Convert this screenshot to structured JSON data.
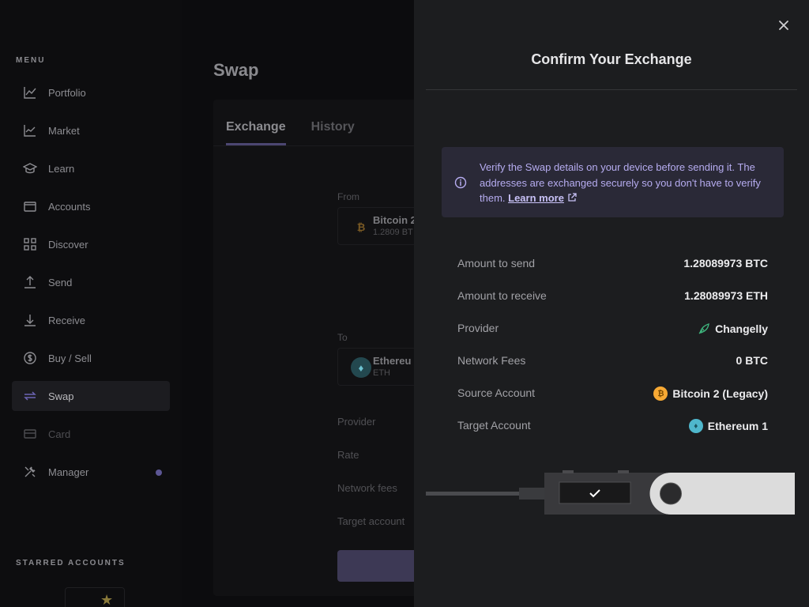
{
  "sidebar": {
    "menu_heading": "MENU",
    "items": [
      {
        "label": "Portfolio",
        "icon": "chart-line-icon"
      },
      {
        "label": "Market",
        "icon": "market-icon"
      },
      {
        "label": "Learn",
        "icon": "graduation-cap-icon"
      },
      {
        "label": "Accounts",
        "icon": "wallet-icon"
      },
      {
        "label": "Discover",
        "icon": "grid-icon"
      },
      {
        "label": "Send",
        "icon": "arrow-up-icon"
      },
      {
        "label": "Receive",
        "icon": "arrow-down-icon"
      },
      {
        "label": "Buy / Sell",
        "icon": "dollar-icon"
      },
      {
        "label": "Swap",
        "icon": "swap-icon",
        "active": true
      },
      {
        "label": "Card",
        "icon": "card-icon",
        "disabled": true
      },
      {
        "label": "Manager",
        "icon": "tools-icon",
        "notification": true
      }
    ],
    "starred_heading": "STARRED ACCOUNTS"
  },
  "main": {
    "title": "Swap",
    "tabs": [
      {
        "label": "Exchange",
        "active": true
      },
      {
        "label": "History",
        "active": false
      }
    ],
    "from_label": "From",
    "from_account": {
      "name": "Bitcoin 2",
      "sub": "1.2809 BT"
    },
    "to_label": "To",
    "to_account": {
      "name": "Ethereu",
      "sub": "ETH"
    },
    "summary_labels": [
      "Provider",
      "Rate",
      "Network fees",
      "Target account"
    ]
  },
  "drawer": {
    "title": "Confirm Your Exchange",
    "alert": {
      "text": "Verify the Swap details on your device before sending it. The addresses are exchanged securely so you don't have to verify them.",
      "link": "Learn more"
    },
    "rows": [
      {
        "label": "Amount to send",
        "value": "1.28089973 BTC"
      },
      {
        "label": "Amount to receive",
        "value": "1.28089973 ETH"
      },
      {
        "label": "Provider",
        "value": "Changelly",
        "icon": "changelly-icon"
      },
      {
        "label": "Network Fees",
        "value": "0 BTC"
      },
      {
        "label": "Source Account",
        "value": "Bitcoin 2 (Legacy)",
        "icon": "bitcoin-icon"
      },
      {
        "label": "Target Account",
        "value": "Ethereum 1",
        "icon": "ethereum-icon"
      }
    ]
  },
  "colors": {
    "accent": "#6490f1",
    "bitcoin": "#f7a934",
    "ethereum": "#4fb7cc",
    "alert_text": "#b6acf0"
  }
}
